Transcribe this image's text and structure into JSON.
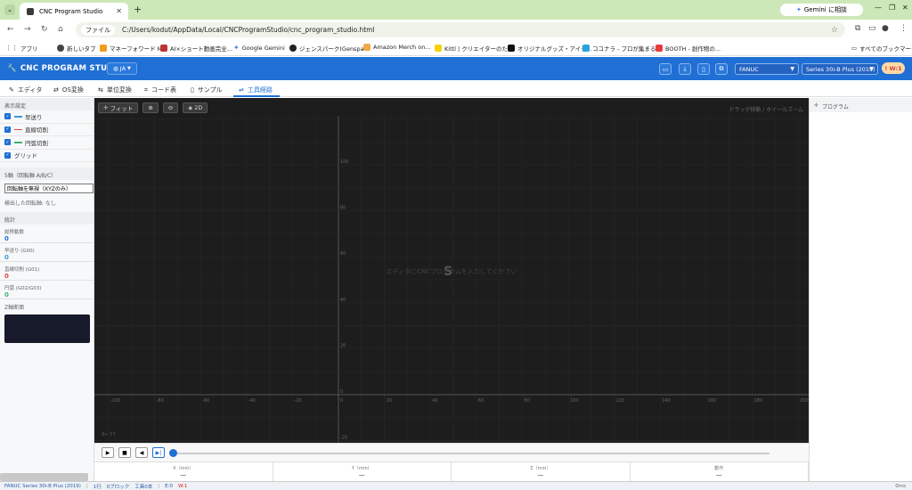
{
  "browser": {
    "tab_title": "CNC Program Studio",
    "address_label": "ファイル",
    "url": "C:/Users/kodut/AppData/Local/CNCProgramStudio/cnc_program_studio.html",
    "gemini_label": "Gemini に相談",
    "bookmarks": [
      "アプリ",
      "新しいタブ",
      "マネーフォワード ME",
      "AI×ショート動画完全...",
      "Google Gemini",
      "ジェンスパーク(Genspa...",
      "Amazon Merch on...",
      "Kittl | クリエイターのた...",
      "オリジナルグッズ・アイテ...",
      "ココナラ - プロが集まる...",
      "BOOTH - 創作物の..."
    ],
    "all_bookmarks": "すべてのブックマーク"
  },
  "app": {
    "title": "CNC PROGRAM STUDIO",
    "lang": "JA",
    "controller": "FANUC",
    "series": "Series 30i-B Plus (2019)",
    "warning_badge": "! W:1"
  },
  "tabs": [
    "エディタ",
    "OS変換",
    "単位変換",
    "コード表",
    "サンプル",
    "工具経路"
  ],
  "left": {
    "display_section": "表示設定",
    "checks": [
      {
        "label": "早送り",
        "color": "#3a9ad9"
      },
      {
        "label": "直線切削",
        "color": "#e04444"
      },
      {
        "label": "円弧切削",
        "color": "#3cb371"
      },
      {
        "label": "グリッド",
        "color": ""
      }
    ],
    "axis_section": "5軸（回転軸 A/B/C）",
    "axis_select": "回転軸を無視（XYZのみ）",
    "detected": "検出した回転軸: なし",
    "stats_section": "統計",
    "stats": [
      {
        "label": "総移動数",
        "value": "0",
        "color": "#1f6fd4"
      },
      {
        "label": "早送り (G00)",
        "value": "0",
        "color": "#3a9ad9"
      },
      {
        "label": "直線切削 (G01)",
        "value": "0",
        "color": "#e04444"
      },
      {
        "label": "円弧 (G02/G03)",
        "value": "0",
        "color": "#3cb371"
      }
    ],
    "z_section": "Z軸断面"
  },
  "canvas": {
    "fit": "フィット",
    "zoom_in": "",
    "zoom_out": "",
    "mode": "2D",
    "hint": "ドラッグ移動 / ホイールズーム",
    "placeholder": "エディタにCNCプログラムを入力してください",
    "x_ticks": [
      "-100",
      "-80",
      "-60",
      "-40",
      "-20",
      "0",
      "20",
      "40",
      "60",
      "80",
      "100",
      "120",
      "140",
      "160",
      "180",
      "200"
    ],
    "y_ticks": [
      "100",
      "80",
      "60",
      "40",
      "20",
      "0",
      "-20"
    ],
    "corner_label": "X← Y↑"
  },
  "coords": [
    {
      "label": "X（mm）",
      "value": "—"
    },
    {
      "label": "Y（mm）",
      "value": "—"
    },
    {
      "label": "Z（mm）",
      "value": "—"
    },
    {
      "label": "動作",
      "value": "—"
    }
  ],
  "right": {
    "header": "プログラム"
  },
  "status": {
    "series": "FANUC Series 30i-B Plus (2019)",
    "lines": "1行",
    "blocks": "0ブロック",
    "tools": "工具0本",
    "errors": "E:0",
    "warnings": "W:1",
    "time": "0ms"
  }
}
